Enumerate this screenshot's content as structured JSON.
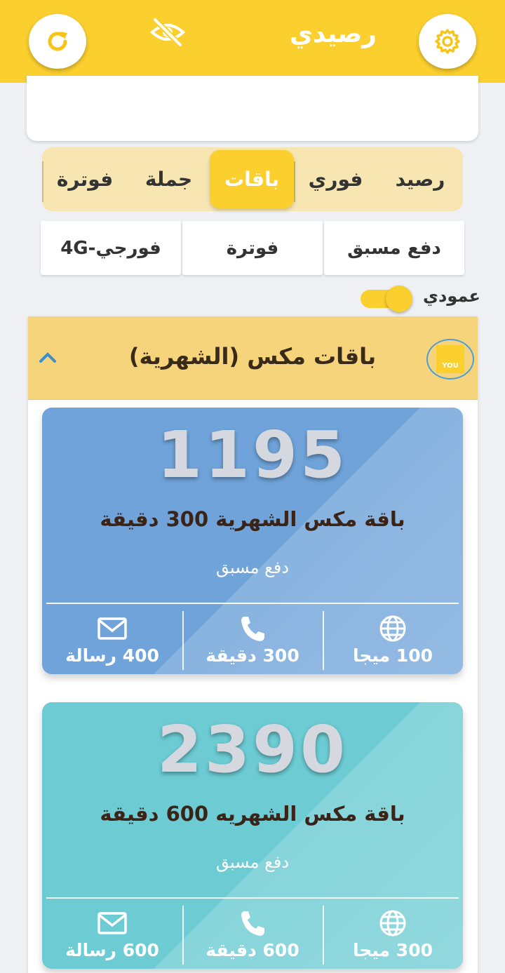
{
  "header": {
    "title": "رصيدي",
    "refresh_icon": "refresh-icon",
    "visibility_icon": "eye-off-icon",
    "settings_icon": "gear-icon",
    "color": "#fbcf2e"
  },
  "tabs": [
    {
      "label": "رصيد",
      "active": false
    },
    {
      "label": "فوري",
      "active": false
    },
    {
      "label": "باقات",
      "active": true
    },
    {
      "label": "جملة",
      "active": false
    },
    {
      "label": "فوترة",
      "active": false
    }
  ],
  "subtabs": [
    "دفع مسبق",
    "فوترة",
    "4G-فورجي"
  ],
  "layout_toggle": {
    "label": "عمودي",
    "on": true
  },
  "group": {
    "title": "باقات مكس (الشهرية)",
    "logo_text": "YOU",
    "expanded": true
  },
  "packages": [
    {
      "price": "1195",
      "name": "باقة مكس الشهرية 300 دقيقة",
      "type": "دفع مسبق",
      "color": "#6fa3d9",
      "data": "100 ميجا",
      "minutes": "300 دقيقة",
      "sms": "400 رسالة"
    },
    {
      "price": "2390",
      "name": "باقة مكس الشهريه 600 دقيقة",
      "type": "دفع مسبق",
      "color": "#6ccbd3",
      "data": "300 ميجا",
      "minutes": "600 دقيقة",
      "sms": "600 رسالة"
    }
  ]
}
